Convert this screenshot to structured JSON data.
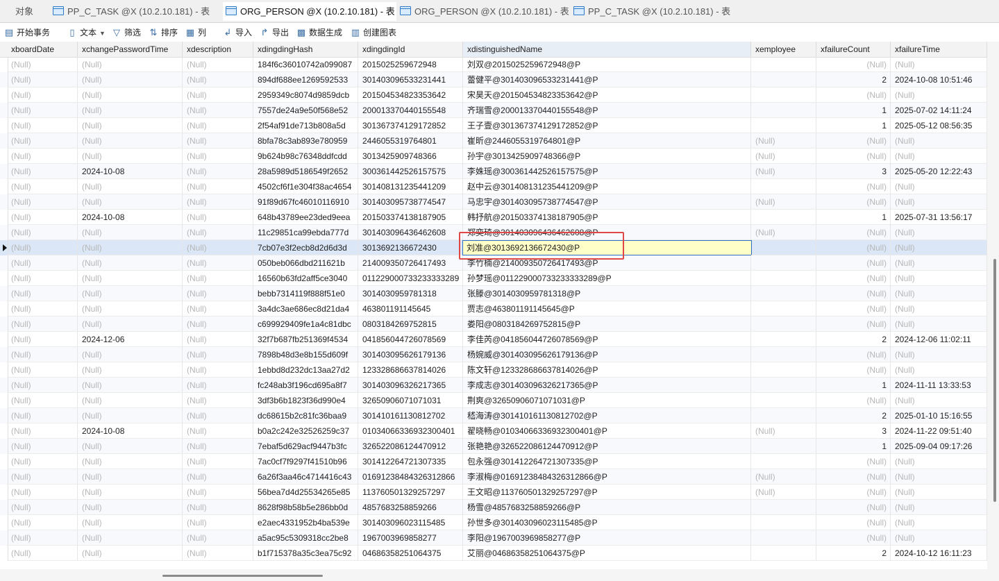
{
  "tabs": [
    {
      "label": "对象",
      "active": false,
      "has_icon": false
    },
    {
      "label": "PP_C_TASK @X (10.2.10.181) - 表",
      "active": false,
      "has_icon": true
    },
    {
      "label": "ORG_PERSON @X (10.2.10.181) - 表",
      "active": true,
      "has_icon": true
    },
    {
      "label": "ORG_PERSON @X (10.2.10.181) - 表",
      "active": false,
      "has_icon": true
    },
    {
      "label": "PP_C_TASK @X (10.2.10.181) - 表",
      "active": false,
      "has_icon": true
    }
  ],
  "toolbar": {
    "begin_transaction": "开始事务",
    "text": "文本",
    "filter": "筛选",
    "sort": "排序",
    "columns": "列",
    "import": "导入",
    "export": "导出",
    "data_generation": "数据生成",
    "create_chart": "创建图表"
  },
  "null_label": "(Null)",
  "columns": [
    "xboardDate",
    "xchangePasswordTime",
    "xdescription",
    "xdingdingHash",
    "xdingdingId",
    "xdistinguishedName",
    "xemployee",
    "xfailureCount",
    "xfailureTime"
  ],
  "selected_column": "xdistinguishedName",
  "current_row_index": 12,
  "rows": [
    [
      null,
      null,
      null,
      "184f6c36010742a099087",
      "2015025259672948",
      "刘双@2015025259672948@P",
      "",
      null,
      null
    ],
    [
      null,
      null,
      null,
      "894df688ee1269592533",
      "301403096533231441",
      "蕾健平@301403096533231441@P",
      "",
      "2",
      "2024-10-08 10:51:46"
    ],
    [
      null,
      null,
      null,
      "2959349c8074d9859dcb",
      "201504534823353642",
      "宋昊天@201504534823353642@P",
      "",
      null,
      null
    ],
    [
      null,
      null,
      null,
      "7557de24a9e50f568e52",
      "200013370440155548",
      "齐瑞雪@200013370440155548@P",
      "",
      "1",
      "2025-07-02 14:11:24"
    ],
    [
      null,
      null,
      null,
      "2f54af91de713b808a5d",
      "301367374129172852",
      "王子壹@301367374129172852@P",
      "",
      "1",
      "2025-05-12 08:56:35"
    ],
    [
      null,
      null,
      null,
      "8bfa78c3ab893e780959",
      "2446055319764801",
      "崔昕@2446055319764801@P",
      null,
      null,
      null
    ],
    [
      null,
      null,
      null,
      "9b624b98c76348ddfcdd",
      "3013425909748366",
      "孙宇@3013425909748366@P",
      null,
      null,
      null
    ],
    [
      null,
      "2024-10-08",
      null,
      "28a5989d5186549f2652",
      "300361442526157575",
      "李姝瑶@300361442526157575@P",
      null,
      "3",
      "2025-05-20 12:22:43"
    ],
    [
      null,
      null,
      null,
      "4502cf6f1e304f38ac4654",
      "301408131235441209",
      "赵中云@301408131235441209@P",
      "",
      null,
      null
    ],
    [
      null,
      null,
      null,
      "91f89d67fc46010116910",
      "301403095738774547",
      "马忠宇@301403095738774547@P",
      null,
      null,
      null
    ],
    [
      null,
      "2024-10-08",
      null,
      "648b43789ee23ded9eea",
      "201503374138187905",
      "韩抒航@201503374138187905@P",
      "",
      "1",
      "2025-07-31 13:56:17"
    ],
    [
      null,
      null,
      null,
      "11c29851ca99ebda777d",
      "301403096436462608",
      "郑奕琦@301403096436462608@P",
      null,
      null,
      null
    ],
    [
      null,
      null,
      null,
      "7cb07e3f2ecb8d2d6d3d",
      "3013692136672430",
      "刘准@3013692136672430@P",
      "",
      null,
      null
    ],
    [
      null,
      null,
      null,
      "050beb066dbd211621b",
      "214009350726417493",
      "李竹楠@214009350726417493@P",
      "",
      null,
      null
    ],
    [
      null,
      null,
      null,
      "16560b63fd2aff5ce3040",
      "011229000733233333289",
      "孙梦瑶@011229000733233333289@P",
      "",
      null,
      null
    ],
    [
      null,
      null,
      null,
      "bebb7314119f888f51e0",
      "3014030959781318",
      "张滕@3014030959781318@P",
      "",
      null,
      null
    ],
    [
      null,
      null,
      null,
      "3a4dc3ae686ec8d21da4",
      "463801191145645",
      "贾志@463801191145645@P",
      "",
      null,
      null
    ],
    [
      null,
      null,
      null,
      "c699929409fe1a4c81dbc",
      "0803184269752815",
      "娄阳@0803184269752815@P",
      "",
      null,
      null
    ],
    [
      null,
      "2024-12-06",
      null,
      "32f7b687fb251369f4534",
      "041856044726078569",
      "李佳芮@041856044726078569@P",
      "",
      "2",
      "2024-12-06 11:02:11"
    ],
    [
      null,
      null,
      null,
      "7898b48d3e8b155d609f",
      "301403095626179136",
      "杨婉威@301403095626179136@P",
      "",
      null,
      null
    ],
    [
      null,
      null,
      null,
      "1ebbd8d232dc13aa27d2",
      "123328686637814026",
      "陈文轩@123328686637814026@P",
      "",
      null,
      null
    ],
    [
      null,
      null,
      null,
      "fc248ab3f196cd695a8f7",
      "301403096326217365",
      "李成志@301403096326217365@P",
      "",
      "1",
      "2024-11-11 13:33:53"
    ],
    [
      null,
      null,
      null,
      "3df3b6b1823f36d990e4",
      "32650906071071031",
      "荆爽@32650906071071031@P",
      "",
      null,
      null
    ],
    [
      null,
      null,
      null,
      "dc68615b2c81fc36baa9",
      "301410161130812702",
      "嵇海涛@301410161130812702@P",
      "",
      "2",
      "2025-01-10 15:16:55"
    ],
    [
      null,
      "2024-10-08",
      null,
      "b0a2c242e32526259c37",
      "01034066336932300401",
      "翟晓畅@01034066336932300401@P",
      null,
      "3",
      "2024-11-22 09:51:40"
    ],
    [
      null,
      null,
      null,
      "7ebaf5d629acf9447b3fc",
      "326522086124470912",
      "张艳艳@326522086124470912@P",
      "",
      "1",
      "2025-09-04 09:17:26"
    ],
    [
      null,
      null,
      null,
      "7ac0cf7f9297f41510b96",
      "301412264721307335",
      "包永强@301412264721307335@P",
      "",
      null,
      null
    ],
    [
      null,
      null,
      null,
      "6a26f3aa46c4714416c43",
      "01691238484326312866",
      "李淑梅@01691238484326312866@P",
      null,
      null,
      null
    ],
    [
      null,
      null,
      null,
      "56bea7d4d25534265e85",
      "113760501329257297",
      "王文昭@113760501329257297@P",
      null,
      null,
      null
    ],
    [
      null,
      null,
      null,
      "8628f98b58b5e286bb0d",
      "4857683258859266",
      "杨雪@4857683258859266@P",
      "",
      null,
      null
    ],
    [
      null,
      null,
      null,
      "e2aec4331952b4ba539e",
      "301403096023115485",
      "孙世多@301403096023115485@P",
      "",
      null,
      null
    ],
    [
      null,
      null,
      null,
      "a5ac95c5309318cc2be8",
      "1967003969858277",
      "李阳@1967003969858277@P",
      "",
      null,
      null
    ],
    [
      null,
      null,
      null,
      "b1f715378a35c3ea75c92",
      "04686358251064375",
      "艾丽@04686358251064375@P",
      "",
      "2",
      "2024-10-12 16:11:23"
    ]
  ]
}
